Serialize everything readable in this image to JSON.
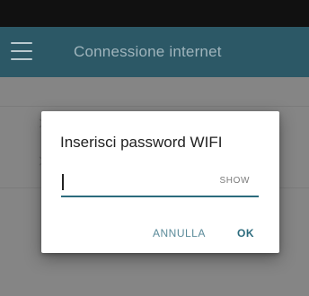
{
  "toolbar": {
    "title": "Connessione internet",
    "menu_icon": "hamburger-menu-icon"
  },
  "dialog": {
    "title": "Inserisci password WIFI",
    "password_value": "",
    "show_label": "SHOW",
    "cancel_label": "ANNULLA",
    "ok_label": "OK"
  },
  "colors": {
    "toolbar_bg": "#2c5866",
    "accent": "#2c6b7d",
    "status_bar": "#111111",
    "overlay_bg": "#858585"
  }
}
